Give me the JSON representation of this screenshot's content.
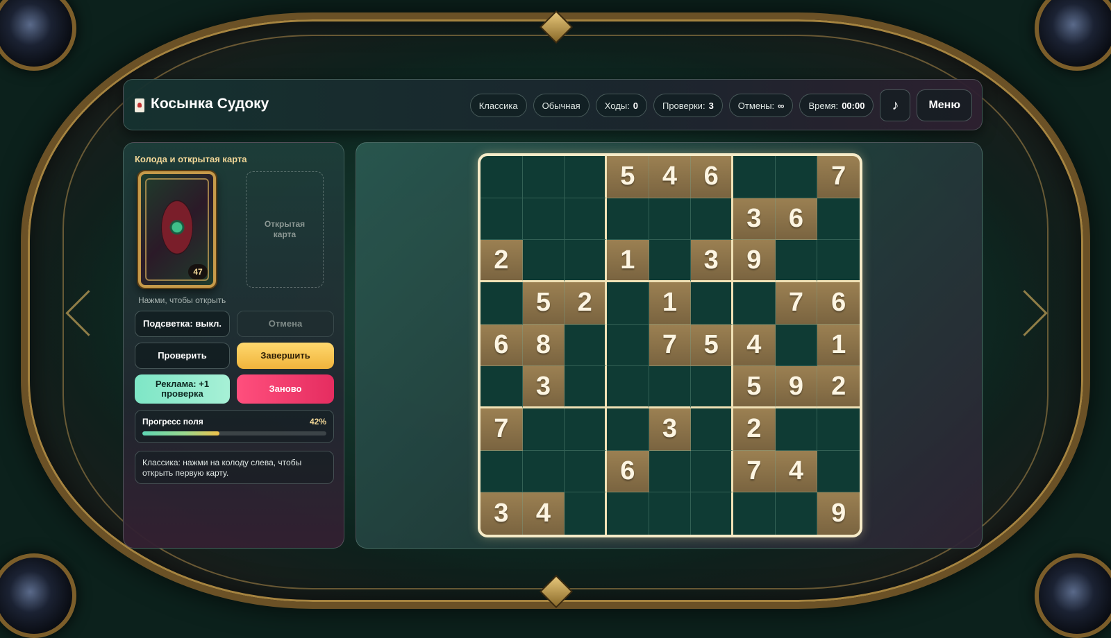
{
  "header": {
    "title": "Косынка Судоку",
    "mode": "Классика",
    "difficulty": "Обычная",
    "moves_label": "Ходы:",
    "moves_value": "0",
    "checks_label": "Проверки:",
    "checks_value": "3",
    "undos_label": "Отмены:",
    "undos_value": "∞",
    "time_label": "Время:",
    "time_value": "00:00",
    "music_icon": "music-note-icon",
    "menu_label": "Меню"
  },
  "sidebar": {
    "title": "Колода и открытая карта",
    "deck_count": "47",
    "open_card_placeholder": "Открытая карта",
    "deck_hint": "Нажми, чтобы открыть",
    "highlight_button": "Подсветка: выкл.",
    "undo_button": "Отмена",
    "check_button": "Проверить",
    "finish_button": "Завершить",
    "ad_button": "Реклама: +1 проверка",
    "restart_button": "Заново",
    "progress_label": "Прогресс поля",
    "progress_value": "42%",
    "progress_fraction": 0.42,
    "hint_text": "Классика: нажми на колоду слева, чтобы открыть первую карту."
  },
  "colors": {
    "accent_gold": "#f3d898",
    "finish_button": "#ffd86e",
    "restart_button": "#ff4f7d",
    "ad_button": "#7ee6c6",
    "empty_cell": "#0f3b34",
    "filled_cell": "#9b8052"
  },
  "board": {
    "rows": [
      [
        "",
        "",
        "",
        "5",
        "4",
        "6",
        "",
        "",
        "7"
      ],
      [
        "",
        "",
        "",
        "",
        "",
        "",
        "3",
        "6",
        ""
      ],
      [
        "2",
        "",
        "",
        "1",
        "",
        "3",
        "9",
        "",
        ""
      ],
      [
        "",
        "5",
        "2",
        "",
        "1",
        "",
        "",
        "7",
        "6"
      ],
      [
        "6",
        "8",
        "",
        "",
        "7",
        "5",
        "4",
        "",
        "1"
      ],
      [
        "",
        "3",
        "",
        "",
        "",
        "",
        "5",
        "9",
        "2"
      ],
      [
        "7",
        "",
        "",
        "",
        "3",
        "",
        "2",
        "",
        ""
      ],
      [
        "",
        "",
        "",
        "6",
        "",
        "",
        "7",
        "4",
        ""
      ],
      [
        "3",
        "4",
        "",
        "",
        "",
        "",
        "",
        "",
        "9"
      ]
    ]
  }
}
